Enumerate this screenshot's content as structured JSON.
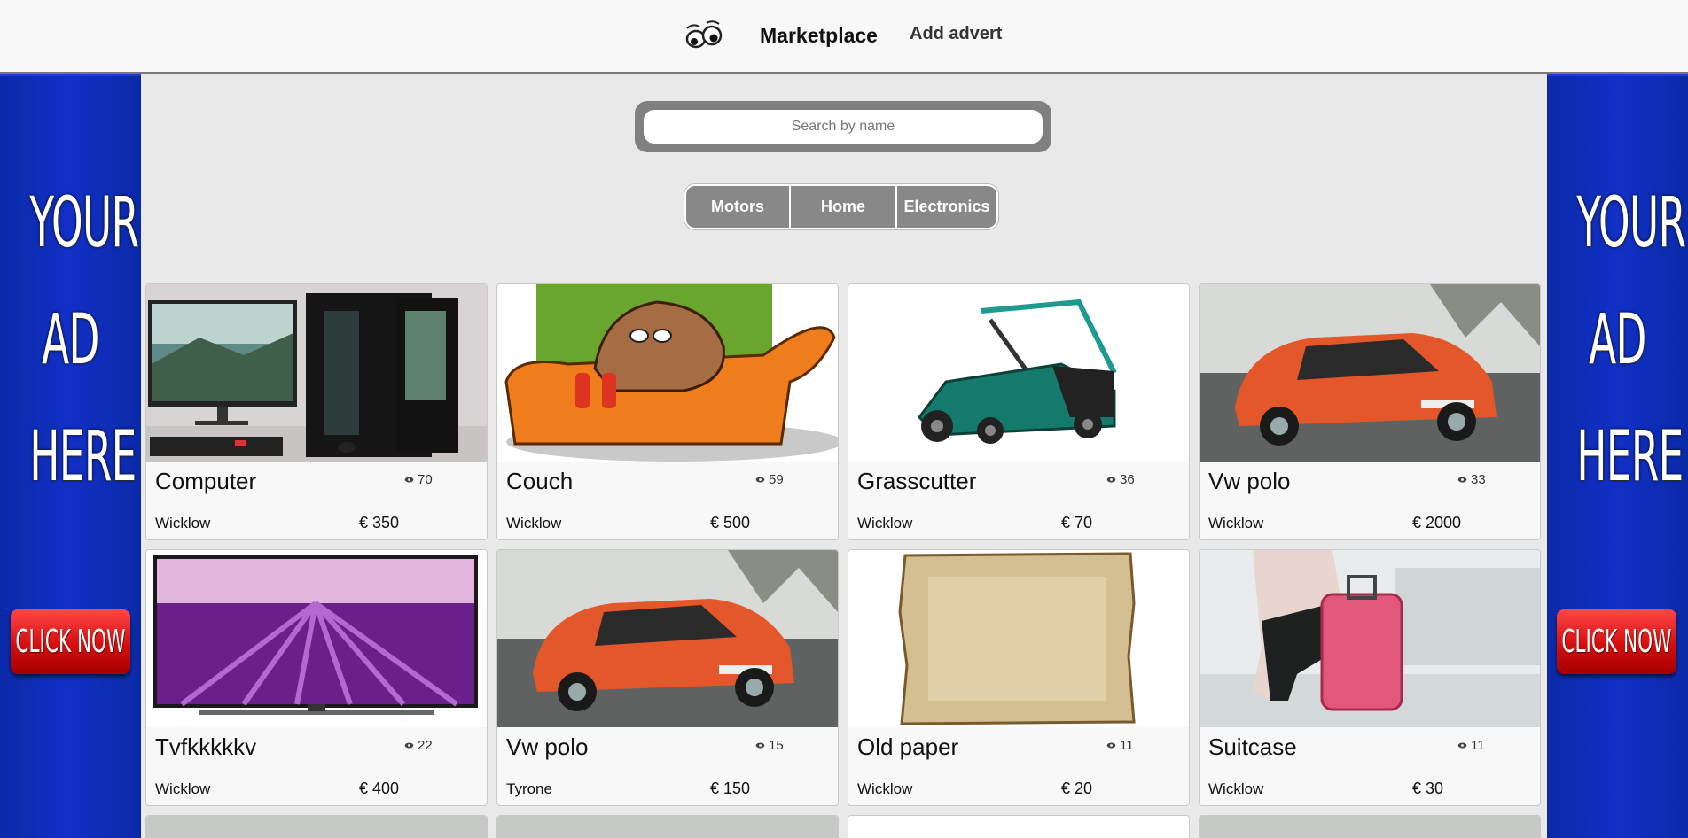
{
  "navbar": {
    "brand": "Marketplace",
    "add_advert": "Add advert",
    "logo_icon": "eyes-logo-icon"
  },
  "ads": {
    "left": {
      "text_lines": [
        "YOUR",
        "AD",
        "HERE"
      ],
      "button": "CLICK NOW"
    },
    "right": {
      "text_lines": [
        "YOUR",
        "AD",
        "HERE"
      ],
      "button": "CLICK NOW"
    }
  },
  "search": {
    "placeholder": "Search by name",
    "value": ""
  },
  "categories": [
    "Motors",
    "Home",
    "Electronics"
  ],
  "listings": [
    {
      "title": "Computer",
      "views": "70",
      "location": "Wicklow",
      "price": "€ 350",
      "image": "computer-image"
    },
    {
      "title": "Couch",
      "views": "59",
      "location": "Wicklow",
      "price": "€ 500",
      "image": "couch-image"
    },
    {
      "title": "Grasscutter",
      "views": "36",
      "location": "Wicklow",
      "price": "€ 70",
      "image": "lawnmower-image"
    },
    {
      "title": "Vw polo",
      "views": "33",
      "location": "Wicklow",
      "price": "€ 2000",
      "image": "orange-car-image"
    },
    {
      "title": "Tvfkkkkkv",
      "views": "22",
      "location": "Wicklow",
      "price": "€ 400",
      "image": "tv-lavender-image"
    },
    {
      "title": "Vw polo",
      "views": "15",
      "location": "Tyrone",
      "price": "€ 150",
      "image": "orange-car-image"
    },
    {
      "title": "Old paper",
      "views": "11",
      "location": "Wicklow",
      "price": "€ 20",
      "image": "old-paper-image"
    },
    {
      "title": "Suitcase",
      "views": "11",
      "location": "Wicklow",
      "price": "€ 30",
      "image": "suitcase-image"
    }
  ],
  "colors": {
    "navbar_bg": "#f8f8f8",
    "page_bg": "#e9e9e9",
    "ad_blue": "#1230c6",
    "ad_red": "#d40e0e",
    "category_gray": "#888888",
    "search_frame": "#808080"
  }
}
